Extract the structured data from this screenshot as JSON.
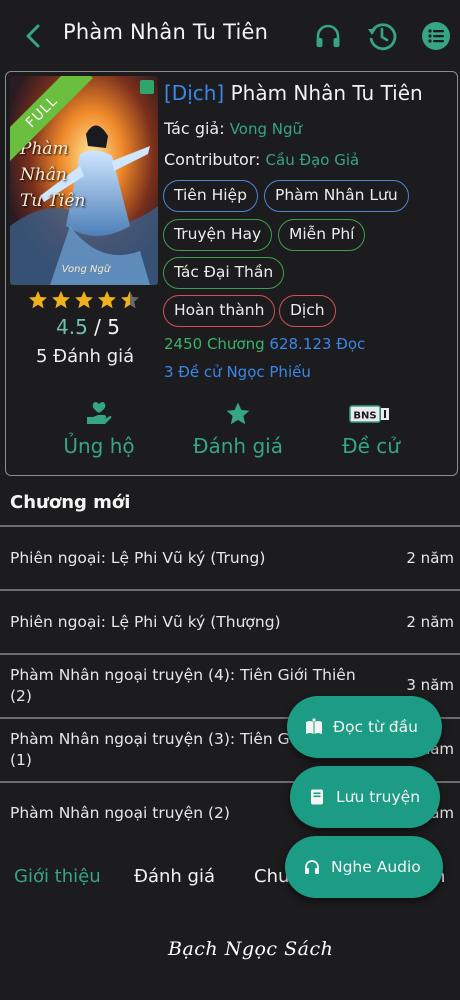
{
  "header": {
    "title": "Phàm Nhân Tu Tiên",
    "icons": [
      "back-icon",
      "headphones-icon",
      "history-icon",
      "menu-list-icon"
    ]
  },
  "book": {
    "cover": {
      "badge": "FULL",
      "art_title": "Phàm Nhân Tu Tiên",
      "art_author": "Vong Ngữ"
    },
    "title_tag": "[Dịch]",
    "title": "Phàm Nhân Tu Tiên",
    "author_label": "Tác giả:",
    "author": "Vong Ngữ",
    "contributor_label": "Contributor:",
    "contributor": "Cầu Đạo Giả",
    "genres": [
      "Tiên Hiệp",
      "Phàm Nhân Lưu"
    ],
    "tags": [
      "Truyện Hay",
      "Miễn Phí",
      "Tác Đại Thần"
    ],
    "status": [
      "Hoàn thành",
      "Dịch"
    ],
    "chapters": "2450 Chương",
    "reads": "628.123 Đọc",
    "nominations": "3 Đề cử Ngọc Phiếu",
    "rating": {
      "score": "4.5",
      "sep": "/",
      "max": "5",
      "stars": 4.5,
      "reviews": "5 Đánh giá"
    },
    "actions": [
      {
        "label": "Ủng hộ",
        "icon": "donate-hand-icon"
      },
      {
        "label": "Đánh giá",
        "icon": "star-icon"
      },
      {
        "label": "Đề cử",
        "icon": "bns-ticket-icon",
        "icon_text": "BNS"
      }
    ]
  },
  "latest": {
    "heading": "Chương mới",
    "chapters": [
      {
        "title": "Phiên ngoại: Lệ Phi Vũ ký (Trung)",
        "time": "2 năm"
      },
      {
        "title": "Phiên ngoại: Lệ Phi Vũ ký (Thượng)",
        "time": "2 năm"
      },
      {
        "title": "Phàm Nhân ngoại truyện (4): Tiên Giới Thiên (2)",
        "time": "3 năm"
      },
      {
        "title": "Phàm Nhân ngoại truyện (3): Tiên G",
        "title_cont": "(1)",
        "time": "năm"
      },
      {
        "title": "Phàm Nhân ngoại truyện (2)",
        "time": "năm"
      }
    ]
  },
  "tabs": [
    "Giới thiệu",
    "Đánh giá",
    "Chư",
    "n"
  ],
  "fabs": [
    {
      "label": "Đọc từ đầu",
      "icon": "open-book-icon"
    },
    {
      "label": "Lưu truyện",
      "icon": "bookmark-book-icon"
    },
    {
      "label": "Nghe Audio",
      "icon": "headphones-icon"
    }
  ],
  "footer": {
    "brand": "Bạch Ngọc Sách"
  },
  "colors": {
    "accent": "#35a583",
    "fab": "#1d9c85",
    "blue": "#3b86e8",
    "green_border": "#3c9e52",
    "red_border": "#d24f5b",
    "badge": "#6bbf3f"
  }
}
